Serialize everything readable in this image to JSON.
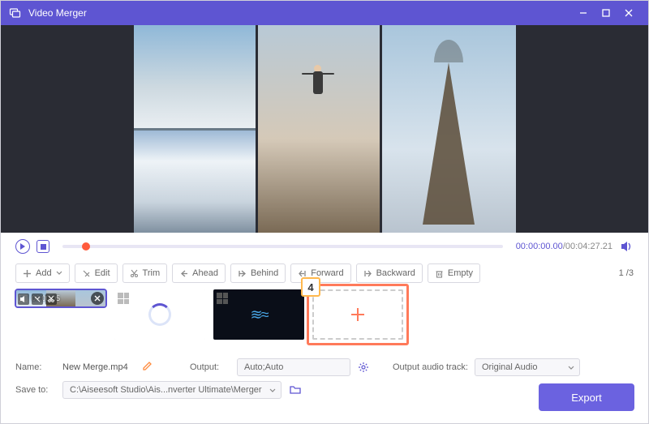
{
  "title": "Video Merger",
  "playback": {
    "current": "00:00:00.00",
    "duration": "00:04:27.21"
  },
  "toolbar": {
    "add": "Add",
    "edit": "Edit",
    "trim": "Trim",
    "ahead": "Ahead",
    "behind": "Behind",
    "forward": "Forward",
    "backward": "Backward",
    "empty": "Empty"
  },
  "pagination": {
    "current": "1",
    "total": "3"
  },
  "clips": {
    "c1_duration": "00:00:05"
  },
  "callout": "4",
  "settings": {
    "name_label": "Name:",
    "name_value": "New Merge.mp4",
    "output_label": "Output:",
    "output_value": "Auto;Auto",
    "audio_label": "Output audio track:",
    "audio_value": "Original Audio",
    "save_label": "Save to:",
    "save_value": "C:\\Aiseesoft Studio\\Ais...nverter Ultimate\\Merger"
  },
  "export_label": "Export"
}
